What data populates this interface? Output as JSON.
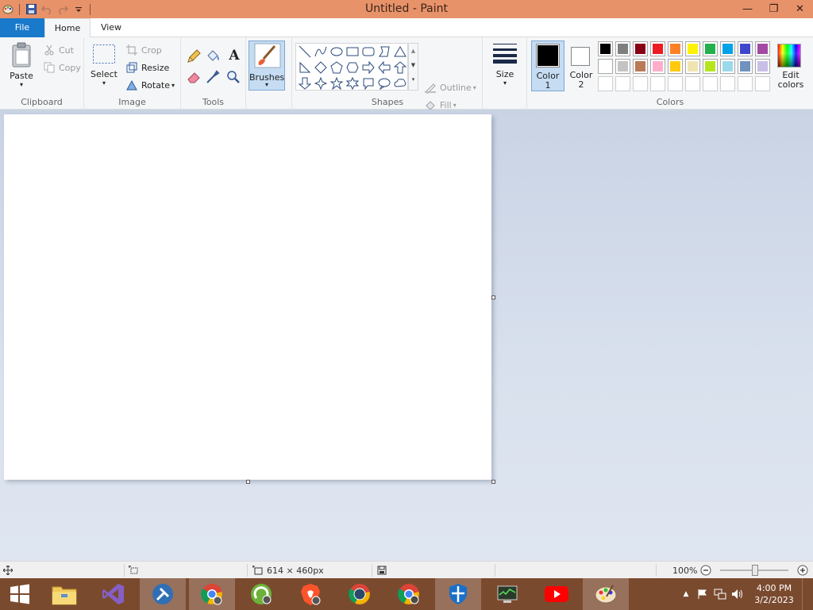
{
  "window": {
    "title": "Untitled - Paint",
    "minimize": "—",
    "restore": "❐",
    "close": "✕"
  },
  "tabs": {
    "file": "File",
    "home": "Home",
    "view": "View"
  },
  "clipboard": {
    "paste": "Paste",
    "cut": "Cut",
    "copy": "Copy",
    "label": "Clipboard"
  },
  "image": {
    "select": "Select",
    "crop": "Crop",
    "resize": "Resize",
    "rotate": "Rotate",
    "label": "Image"
  },
  "tools": {
    "label": "Tools",
    "text_tool": "A"
  },
  "brushes": {
    "label": "Brushes"
  },
  "shapes": {
    "outline": "Outline",
    "fill": "Fill",
    "label": "Shapes"
  },
  "size": {
    "label": "Size"
  },
  "colors": {
    "color1_line1": "Color",
    "color1_line2": "1",
    "color2_line1": "Color",
    "color2_line2": "2",
    "edit_line1": "Edit",
    "edit_line2": "colors",
    "label": "Colors",
    "color1_value": "#000000",
    "color2_value": "#ffffff",
    "palette_row1": [
      "#000000",
      "#7f7f7f",
      "#880015",
      "#ed1c24",
      "#ff7f27",
      "#fff200",
      "#22b14c",
      "#00a2e8",
      "#3f48cc",
      "#a349a4"
    ],
    "palette_row2": [
      "#ffffff",
      "#c3c3c3",
      "#b97a57",
      "#ffaec9",
      "#ffc90e",
      "#efe4b0",
      "#b5e61d",
      "#99d9ea",
      "#7092be",
      "#c8bfe7"
    ]
  },
  "statusbar": {
    "dimensions": "614 × 460px",
    "zoom": "100%"
  },
  "taskbar": {
    "time": "4:00 PM",
    "date": "3/2/2023",
    "apps": [
      "start-icon",
      "file-explorer-icon",
      "visual-studio-icon",
      "tools-icon",
      "chrome-icon",
      "camtasia-icon",
      "brave-icon",
      "chrome-profile-icon",
      "chrome-profile-2-icon",
      "defender-icon",
      "task-manager-icon",
      "youtube-icon",
      "paint-icon"
    ]
  }
}
